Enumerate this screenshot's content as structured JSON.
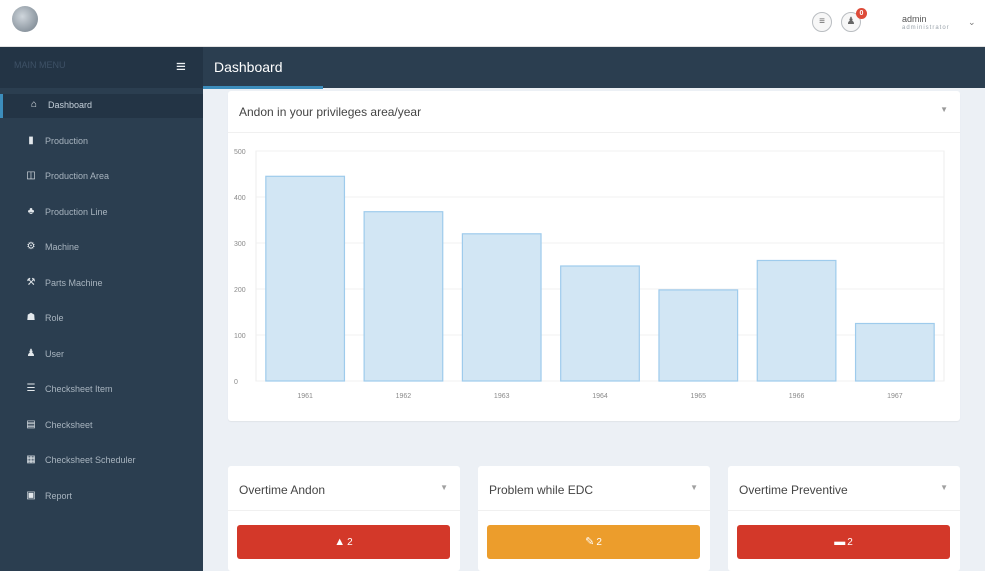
{
  "colors": {
    "navy": "#2b3e50",
    "accent": "#3c8dbc",
    "danger": "#d33829",
    "warning": "#ec9d2c",
    "bar_fill": "#d2e6f4",
    "bar_stroke": "#9ecbec"
  },
  "topbar": {
    "icons": [
      "logo",
      "message-icon",
      "bell-icon"
    ],
    "notification_count": "0",
    "user": {
      "name": "admin",
      "role": "administrator"
    }
  },
  "sidebar": {
    "brand": "MAIN MENU",
    "items": [
      {
        "label": "Dashboard",
        "icon": "home-icon",
        "glyph": "⌂",
        "active": true
      },
      {
        "label": "Production",
        "icon": "bookmark-icon",
        "glyph": "▮"
      },
      {
        "label": "Production Area",
        "icon": "columns-icon",
        "glyph": "◫"
      },
      {
        "label": "Production Line",
        "icon": "sitemap-icon",
        "glyph": "♣"
      },
      {
        "label": "Machine",
        "icon": "cogs-icon",
        "glyph": "⚙"
      },
      {
        "label": "Parts Machine",
        "icon": "wrench-icon",
        "glyph": "⚒"
      },
      {
        "label": "Role",
        "icon": "users-icon",
        "glyph": "☗"
      },
      {
        "label": "User",
        "icon": "user-icon",
        "glyph": "♟"
      },
      {
        "label": "Checksheet Item",
        "icon": "list-icon",
        "glyph": "☰"
      },
      {
        "label": "Checksheet",
        "icon": "file-icon",
        "glyph": "▤"
      },
      {
        "label": "Checksheet Scheduler",
        "icon": "calendar-icon",
        "glyph": "▦"
      },
      {
        "label": "Report",
        "icon": "report-icon",
        "glyph": "▣"
      }
    ]
  },
  "header": {
    "title": "Dashboard"
  },
  "andon_panel": {
    "title": "Andon in your privileges area/year"
  },
  "chart_data": {
    "type": "bar",
    "title": "Andon in your privileges area/year",
    "categories": [
      "1961",
      "1962",
      "1963",
      "1964",
      "1965",
      "1966",
      "1967"
    ],
    "values": [
      445,
      368,
      320,
      250,
      198,
      262,
      125
    ],
    "ylim": [
      0,
      500
    ],
    "yticks": [
      0,
      100,
      200,
      300,
      400,
      500
    ],
    "xlabel": "",
    "ylabel": "",
    "grid": true
  },
  "cards": [
    {
      "title": "Overtime Andon",
      "value": "2",
      "icon": "warning-icon",
      "glyph": "▲",
      "color": "danger"
    },
    {
      "title": "Problem while EDC",
      "value": "2",
      "icon": "edit-icon",
      "glyph": "✎",
      "color": "warning"
    },
    {
      "title": "Overtime Preventive",
      "value": "2",
      "icon": "bed-icon",
      "glyph": "▬",
      "color": "danger"
    }
  ]
}
